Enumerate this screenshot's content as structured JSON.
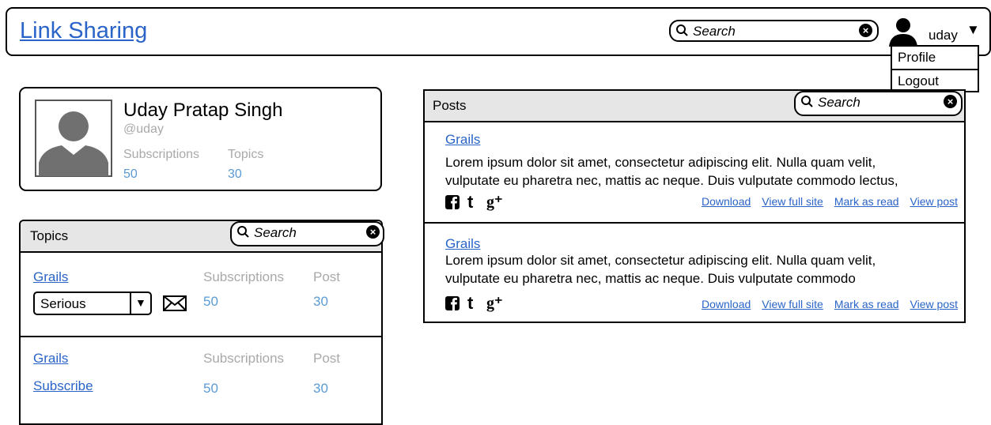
{
  "header": {
    "title": "Link Sharing",
    "search_placeholder": "Search",
    "username": "uday"
  },
  "user_menu": {
    "items": [
      "Profile",
      "Logout"
    ]
  },
  "profile": {
    "name": "Uday Pratap Singh",
    "handle": "@uday",
    "subscriptions_label": "Subscriptions",
    "topics_label": "Topics",
    "subscriptions_count": "50",
    "topics_count": "30"
  },
  "topics_panel": {
    "title": "Topics",
    "search_placeholder": "Search",
    "items": [
      {
        "name": "Grails",
        "seriousness": "Serious",
        "subscriptions_label": "Subscriptions",
        "post_label": "Post",
        "subscriptions": "50",
        "posts": "30"
      },
      {
        "name": "Grails",
        "action": "Subscribe",
        "subscriptions_label": "Subscriptions",
        "post_label": "Post",
        "subscriptions": "50",
        "posts": "30"
      }
    ]
  },
  "posts_panel": {
    "title": "Posts",
    "search_placeholder": "Search",
    "items": [
      {
        "topic": "Grails",
        "text_line1": "Lorem ipsum dolor sit amet, consectetur adipiscing elit. Nulla quam velit,",
        "text_line2": "vulputate eu pharetra nec, mattis ac neque. Duis vulputate commodo lectus,",
        "actions": [
          "Download",
          "View full site",
          "Mark as read",
          "View post"
        ]
      },
      {
        "topic": "Grails",
        "text_line1": "Lorem ipsum dolor sit amet, consectetur adipiscing elit. Nulla quam velit,",
        "text_line2": "vulputate eu pharetra nec, mattis ac neque. Duis vulputate commodo",
        "actions": [
          "Download",
          "View full site",
          "Mark as read",
          "View post"
        ]
      }
    ]
  },
  "icons": {
    "search": "search-icon",
    "clear": "clear-icon",
    "user": "user-icon",
    "mail": "mail-icon",
    "facebook": "facebook-icon",
    "twitter": "twitter-icon",
    "googleplus": "google-plus-icon"
  },
  "colors": {
    "link": "#2a64c8",
    "muted": "#a9a9a9",
    "number": "#5b9bd5",
    "panel_header": "#e6e6e6"
  },
  "glyphs": {
    "clear": "×",
    "caret": "▼",
    "twitter": "t",
    "googleplus": "g⁺"
  }
}
